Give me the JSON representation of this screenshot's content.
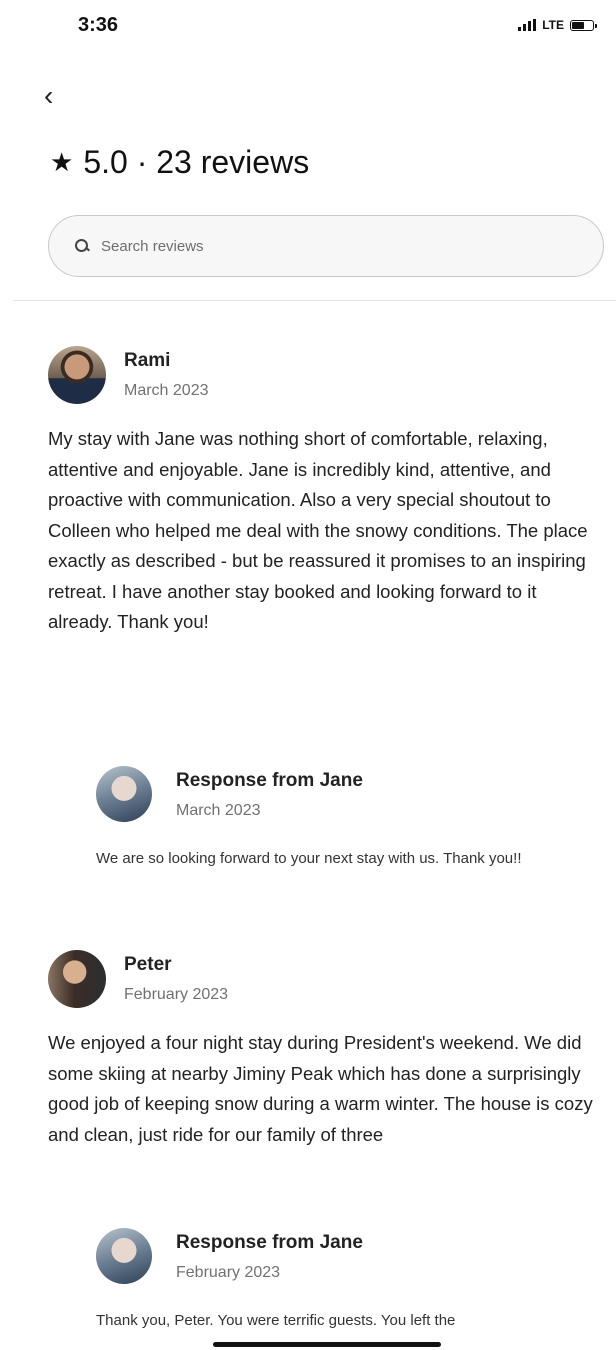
{
  "status_bar": {
    "time": "3:36",
    "network": "LTE",
    "battery_level": 0.55
  },
  "header": {
    "back_icon": "chevron-left-icon",
    "rating": "5.0",
    "separator": "·",
    "review_count": "23 reviews"
  },
  "search": {
    "placeholder": "Search reviews",
    "icon": "search-icon"
  },
  "reviews": [
    {
      "name": "Rami",
      "date": "March 2023",
      "text": "My stay with Jane was nothing short of comfortable, relaxing, attentive and enjoyable. Jane is incredibly kind, attentive, and proactive with communication. Also a very special shoutout to Colleen who helped me deal with the snowy conditions. The place exactly as described - but be reassured it promises to an inspiring retreat. I have another stay booked and looking forward to it already. Thank you!",
      "response": {
        "title": "Response from Jane",
        "date": "March 2023",
        "text": "We are so looking forward to your next stay with us. Thank you!!"
      }
    },
    {
      "name": "Peter",
      "date": "February 2023",
      "text": "We enjoyed a four night stay during President's weekend. We did some skiing at nearby Jiminy Peak which has done a surprisingly good job of keeping snow during a warm winter. The house is cozy and clean, just ride for our family of three",
      "response": {
        "title": "Response from Jane",
        "date": "February 2023",
        "text": "Thank you, Peter. You were terrific guests. You left the"
      }
    }
  ]
}
